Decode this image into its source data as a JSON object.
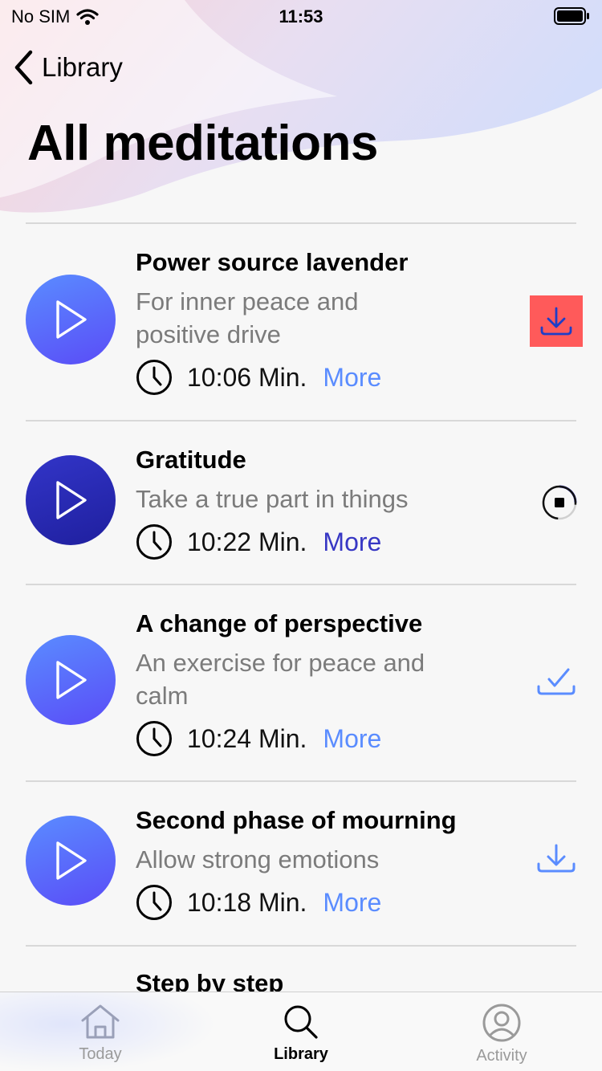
{
  "status_bar": {
    "carrier": "No SIM",
    "time": "11:53"
  },
  "nav": {
    "back_label": "Library"
  },
  "page": {
    "title": "All meditations"
  },
  "meditations": [
    {
      "title": "Power source lavender",
      "subtitle_lines": [
        "For inner peace and",
        "positive drive"
      ],
      "duration": "10:06 Min.",
      "more_label": "More",
      "action_icon": "download-icon",
      "action_state": "highlighted",
      "play_style": "light"
    },
    {
      "title": "Gratitude",
      "subtitle_lines": [
        "Take a true part in things"
      ],
      "duration": "10:22 Min.",
      "more_label": "More",
      "action_icon": "stop-download-icon",
      "action_state": "downloading",
      "play_style": "dark"
    },
    {
      "title": "A change of perspective",
      "subtitle_lines": [
        "An exercise for peace and",
        "calm"
      ],
      "duration": "10:24 Min.",
      "more_label": "More",
      "action_icon": "downloaded-check-icon",
      "action_state": "downloaded",
      "play_style": "light"
    },
    {
      "title": "Second phase of mourning",
      "subtitle_lines": [
        "Allow strong emotions"
      ],
      "duration": "10:18 Min.",
      "more_label": "More",
      "action_icon": "download-icon",
      "action_state": "available",
      "play_style": "light"
    },
    {
      "title": "Step by step"
    }
  ],
  "tab_bar": {
    "tabs": [
      {
        "label": "Today",
        "icon": "home-icon",
        "active": false
      },
      {
        "label": "Library",
        "icon": "search-icon",
        "active": true
      },
      {
        "label": "Activity",
        "icon": "profile-icon",
        "active": false
      }
    ]
  },
  "colors": {
    "accent_blue": "#5a8cff",
    "accent_dark": "#3737c4",
    "download_highlight": "#ff5a5a",
    "subtitle_gray": "#7b7b7b"
  }
}
